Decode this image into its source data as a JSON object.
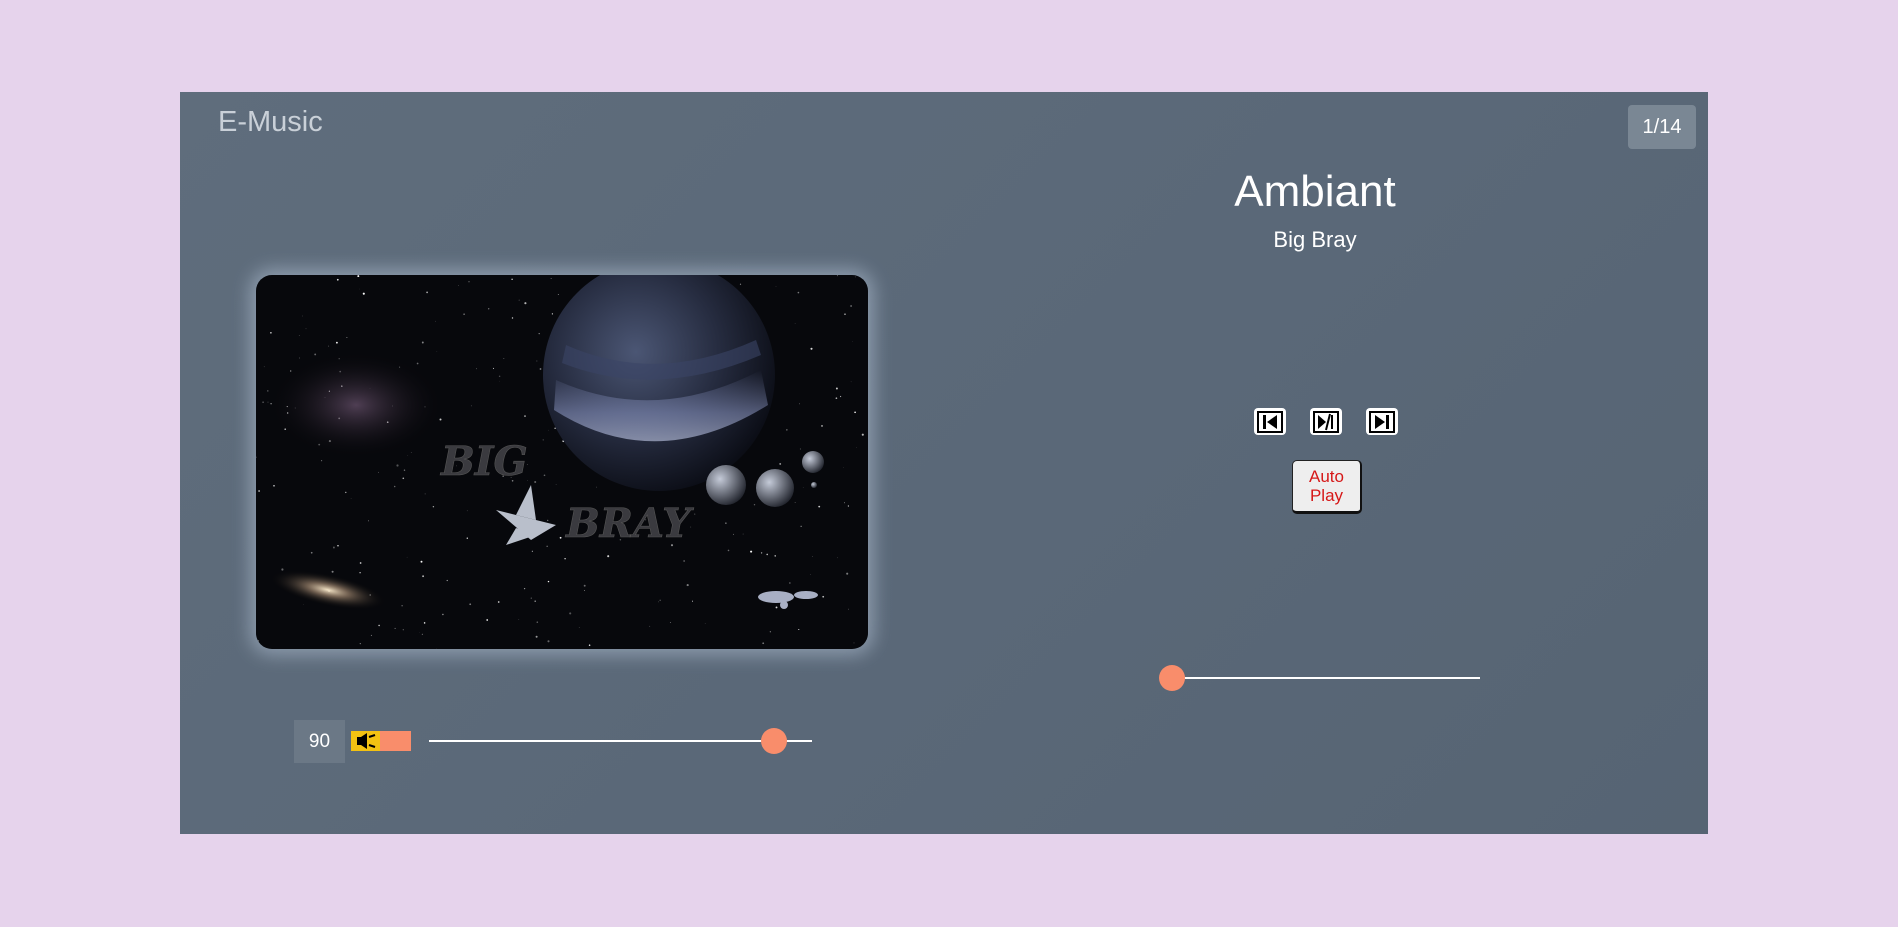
{
  "app": {
    "title": "E-Music",
    "track_counter": "1/14"
  },
  "cover": {
    "description_text_line1": "BIG",
    "description_text_line2": "BRAY"
  },
  "song": {
    "title": "Ambiant",
    "artist": "Big Bray"
  },
  "controls": {
    "previous_icon": "skip-previous-icon",
    "play_pause_icon": "play-pause-icon",
    "next_icon": "skip-next-icon",
    "autoplay_label": "Auto\nPlay"
  },
  "progress": {
    "fraction": 0.0
  },
  "volume": {
    "value": "90",
    "level": 0.9,
    "mute_icon": "speaker-mute-icon"
  },
  "colors": {
    "page_background": "#e6d3ec",
    "player_background": "#5a6878",
    "accent": "#f98d6b",
    "speaker_icon_background": "#f3c212",
    "autoplay_text": "#d61818"
  }
}
